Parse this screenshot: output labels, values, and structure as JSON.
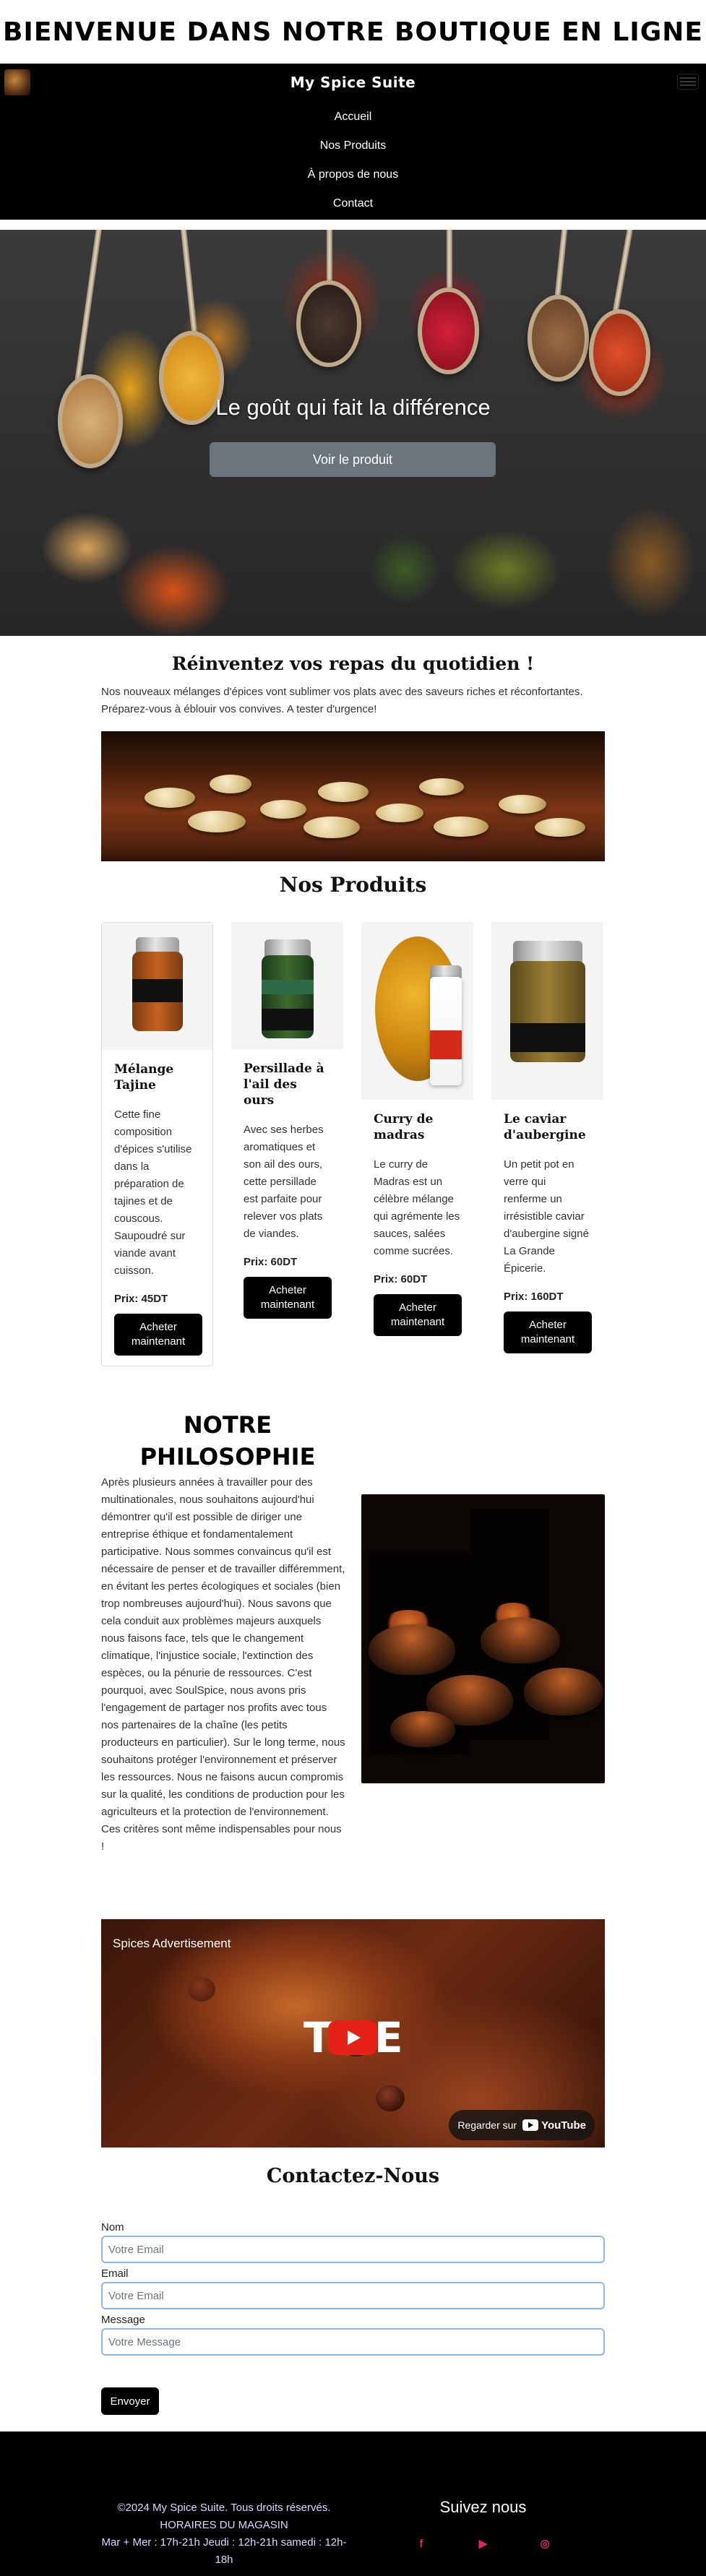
{
  "welcome": {
    "title": "Bienvenue dans notre boutique en ligne"
  },
  "navbar": {
    "brand": "My Spice Suite",
    "links": [
      "Accueil",
      "Nos Produits",
      "À propos de nous",
      "Contact"
    ]
  },
  "hero": {
    "caption": "Le goût qui fait la différence",
    "button": "Voir le produit"
  },
  "intro": {
    "title": "Réinventez vos repas du quotidien !",
    "text": "Nos nouveaux mélanges d'épices vont sublimer vos plats avec des saveurs riches et réconfortantes. Préparez-vous à éblouir vos convives. A tester d'urgence!"
  },
  "products": {
    "title": "Nos Produits",
    "items": [
      {
        "name": "Mélange Tajine",
        "description": "Cette fine composition d'épices s'utilise dans la préparation de tajines et de couscous. Saupoudré sur viande avant cuisson.",
        "price": "Prix: 45DT",
        "button": "Acheter maintenant"
      },
      {
        "name": "Persillade à l'ail des ours",
        "description": "Avec ses herbes aromatiques et son ail des ours, cette persillade est parfaite pour relever vos plats de viandes.",
        "price": "Prix: 60DT",
        "button": "Acheter maintenant"
      },
      {
        "name": "Curry de madras",
        "description": "Le curry de Madras est un célèbre mélange qui agrémente les sauces, salées comme sucrées.",
        "price": "Prix: 60DT",
        "button": "Acheter maintenant"
      },
      {
        "name": "Le caviar d'aubergine",
        "description": "Un petit pot en verre qui renferme un irrésistible caviar d'aubergine signé La Grande Épicerie.",
        "price": "Prix: 160DT",
        "button": "Acheter maintenant"
      }
    ]
  },
  "philosophy": {
    "title": "Notre Philosophie",
    "text": "Après plusieurs années à travailler pour des multinationales, nous souhaitons aujourd'hui démontrer qu'il est possible de diriger une entreprise éthique et fondamentalement participative. Nous sommes convaincus qu'il est nécessaire de penser et de travailler différemment, en évitant les pertes écologiques et sociales (bien trop nombreuses aujourd'hui). Nous savons que cela conduit aux problèmes majeurs auxquels nous faisons face, tels que le changement climatique, l'injustice sociale, l'extinction des espèces, ou la pénurie de ressources. C'est pourquoi, avec SoulSpice, nous avons pris l'engagement de partager nos profits avec tous nos partenaires de la chaîne (les petits producteurs en particulier). Sur le long terme, nous souhaitons protéger l'environnement et préserver les ressources. Nous ne faisons aucun compromis sur la qualité, les conditions de production pour les agriculteurs et la protection de l'environnement. Ces critères sont même indispensables pour nous !"
  },
  "video": {
    "title": "Spices Advertisement",
    "watch_label": "Regarder sur",
    "youtube": "YouTube"
  },
  "contact": {
    "title": "Contactez-Nous",
    "name_label": "Nom",
    "name_placeholder": "Votre Email",
    "email_label": "Email",
    "email_placeholder": "Votre Email",
    "message_label": "Message",
    "message_placeholder": "Votre Message",
    "send": "Envoyer"
  },
  "footer": {
    "copyright": "©2024 My Spice Suite. Tous droits réservés.",
    "hours_title": "HORAIRES DU MAGASIN",
    "hours": "Mar + Mer : 17h-21h Jeudi : 12h-21h samedi : 12h-18h",
    "follow": "Suivez nous",
    "socials": [
      "facebook-icon",
      "youtube-icon",
      "instagram-icon"
    ]
  },
  "colors": {
    "accent": "#000000",
    "hero_button": "#6c757d",
    "input_border": "#8fb5ee",
    "social": "#e0245e"
  }
}
